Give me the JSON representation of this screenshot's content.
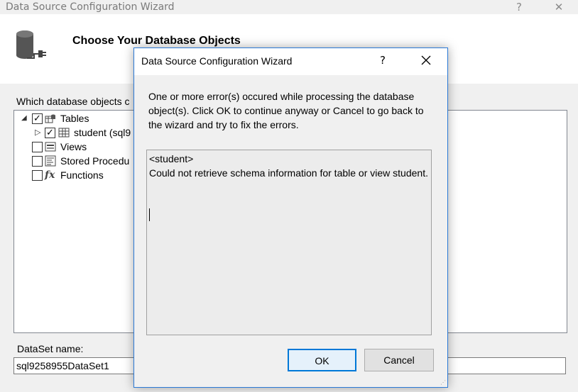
{
  "main_window": {
    "title": "Data Source Configuration Wizard",
    "help_glyph": "?",
    "close_glyph": "✕",
    "header_title": "Choose Your Database Objects",
    "prompt": "Which database objects c",
    "tree": {
      "tables": "Tables",
      "student": "student (sql9",
      "views": "Views",
      "stored_procedures": "Stored Procedu",
      "functions": "Functions"
    },
    "dataset_label": "DataSet name:",
    "dataset_value": "sql9258955DataSet1"
  },
  "dialog": {
    "title": "Data Source Configuration Wizard",
    "help_glyph": "?",
    "message": "One or more error(s) occured while processing the database object(s). Click OK to continue anyway or Cancel to go back to the wizard and try to fix the errors.",
    "detail_line1": "<student>",
    "detail_line2": "Could not retrieve schema information for table or view student.",
    "ok_label": "OK",
    "cancel_label": "Cancel"
  },
  "icons": {
    "database": "database-icon",
    "table": "table-icon",
    "view": "view-icon",
    "stored_procedure": "stored-procedure-icon",
    "function": "function-icon"
  },
  "colors": {
    "accent": "#0078d7",
    "dialog_border": "#2b79d6"
  }
}
